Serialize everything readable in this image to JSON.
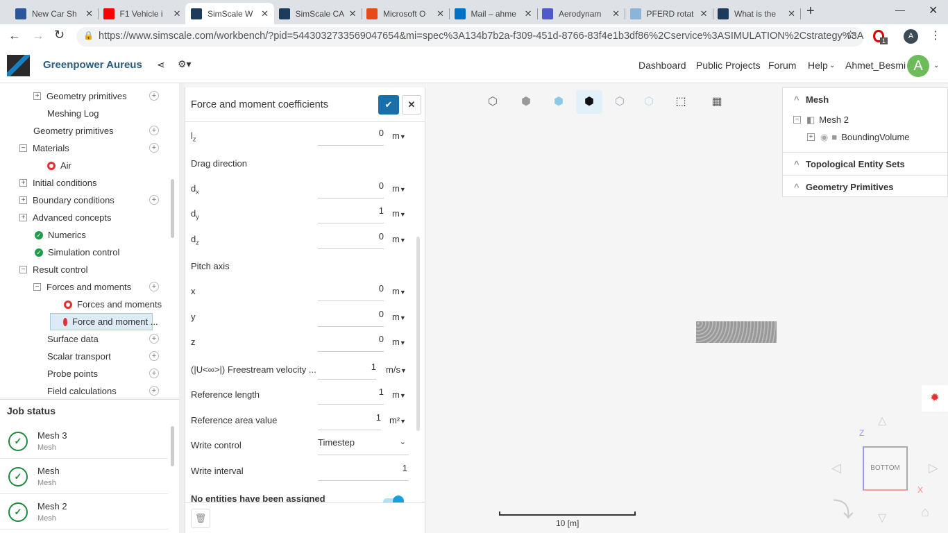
{
  "browser": {
    "tabs": [
      {
        "label": "New Car Sh",
        "color": "#2b579a"
      },
      {
        "label": "F1 Vehicle i",
        "color": "#ff0000"
      },
      {
        "label": "SimScale W",
        "color": "#1d3b5a",
        "active": true
      },
      {
        "label": "SimScale CA",
        "color": "#1d3b5a"
      },
      {
        "label": "Microsoft O",
        "color": "#e64a19"
      },
      {
        "label": "Mail – ahme",
        "color": "#0072c6"
      },
      {
        "label": "Aerodynam",
        "color": "#5059c9"
      },
      {
        "label": "PFERD rotat",
        "color": "#8ab4d8"
      },
      {
        "label": "What is the",
        "color": "#1d3b5a"
      }
    ],
    "new_tab": "+",
    "url": "https://www.simscale.com/workbench/?pid=5443032733569047654&mi=spec%3A134b7b2a-f309-451d-8766-83f4e1b3df86%2Cservice%3ASIMULATION%2Cstrategy%3A...",
    "ext_badge": "1",
    "profile": "A"
  },
  "app": {
    "project": "Greenpower Aureus",
    "nav": [
      "Dashboard",
      "Public Projects",
      "Forum",
      "Help"
    ],
    "user": "Ahmet_Besmi",
    "avatar": "A",
    "accent": "#1aa0d8"
  },
  "tree": [
    {
      "label": "Geometry primitives",
      "level": 2,
      "pm": "+",
      "plus": true
    },
    {
      "label": "Meshing Log",
      "level": 2
    },
    {
      "label": "Geometry primitives",
      "level": 1,
      "plus": true
    },
    {
      "label": "Materials",
      "level": 1,
      "pm": "−",
      "plus": true
    },
    {
      "label": "Air",
      "level": 2,
      "status": "ring"
    },
    {
      "label": "Initial conditions",
      "level": 1,
      "pm": "+"
    },
    {
      "label": "Boundary conditions",
      "level": 1,
      "pm": "+",
      "plus": true
    },
    {
      "label": "Advanced concepts",
      "level": 1,
      "pm": "+"
    },
    {
      "label": "Numerics",
      "level": 1,
      "status": "ok"
    },
    {
      "label": "Simulation control",
      "level": 1,
      "status": "ok"
    },
    {
      "label": "Result control",
      "level": 1,
      "pm": "−"
    },
    {
      "label": "Forces and moments",
      "level": 2,
      "pm": "−",
      "plus": true
    },
    {
      "label": "Forces and moments",
      "level": 3,
      "status": "ring"
    },
    {
      "label": "Force and moment ...",
      "level": 3,
      "status": "ring",
      "selected": true
    },
    {
      "label": "Surface data",
      "level": 2,
      "plus": true
    },
    {
      "label": "Scalar transport",
      "level": 2,
      "plus": true
    },
    {
      "label": "Probe points",
      "level": 2,
      "plus": true
    },
    {
      "label": "Field calculations",
      "level": 2,
      "plus": true
    }
  ],
  "job_status": {
    "title": "Job status",
    "items": [
      {
        "name": "Mesh 3",
        "type": "Mesh"
      },
      {
        "name": "Mesh",
        "type": "Mesh"
      },
      {
        "name": "Mesh 2",
        "type": "Mesh"
      }
    ]
  },
  "form": {
    "title": "Force and moment coefficients",
    "fields": [
      {
        "label": "lz",
        "value": "0",
        "unit": "m"
      },
      {
        "heading": "Drag direction"
      },
      {
        "label": "dx",
        "value": "0",
        "unit": "m"
      },
      {
        "label": "dy",
        "value": "1",
        "unit": "m"
      },
      {
        "label": "dz",
        "value": "0",
        "unit": "m"
      },
      {
        "heading": "Pitch axis"
      },
      {
        "label": "x",
        "value": "0",
        "unit": "m"
      },
      {
        "label": "y",
        "value": "0",
        "unit": "m"
      },
      {
        "label": "z",
        "value": "0",
        "unit": "m"
      },
      {
        "label": "(|U<∞>|) Freestream velocity ...",
        "value": "1",
        "unit": "m/s"
      },
      {
        "label": "Reference length",
        "value": "1",
        "unit": "m"
      },
      {
        "label": "Reference area value",
        "value": "1",
        "unit": "m²"
      },
      {
        "label": "Write control",
        "select": "Timestep"
      },
      {
        "label": "Write interval",
        "value": "1"
      }
    ],
    "entities": "No entities have been assigned"
  },
  "right": {
    "mesh": "Mesh",
    "mesh_item": "Mesh 2",
    "child": "BoundingVolume",
    "topo": "Topological Entity Sets",
    "geom": "Geometry Primitives"
  },
  "viewport": {
    "scale": "10 [m]",
    "cube_face": "BOTTOM",
    "axis_z": "Z",
    "axis_x": "X"
  }
}
